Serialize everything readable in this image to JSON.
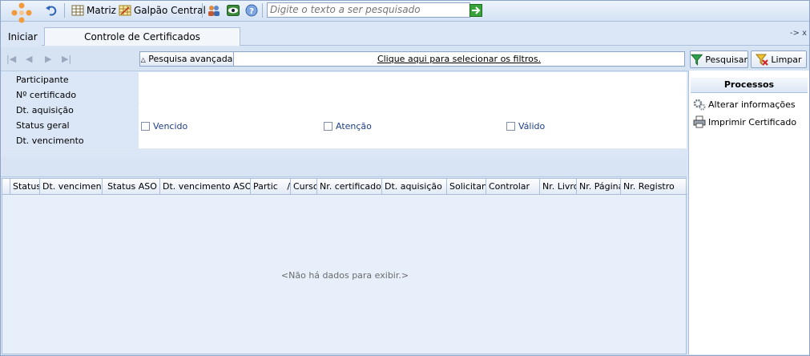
{
  "toolbar": {
    "matriz_label": "Matriz",
    "galpao_label": "Galpão Central",
    "search_placeholder": "Digite o texto a ser pesquisado"
  },
  "start": {
    "label": "Iniciar"
  },
  "tabs": [
    {
      "label": "Controle de Certificados"
    }
  ],
  "filters": {
    "advanced_label": "Pesquisa avançada",
    "select_filters_text": "Clique aqui para selecionar os filtros.",
    "search_button": "Pesquisar",
    "clear_button": "Limpar"
  },
  "form": {
    "participante_label": "Participante",
    "certificado_label": "Nº certificado",
    "aquisicao_label": "Dt. aquisição",
    "status_label": "Status geral",
    "vencimento_label": "Dt. vencimento",
    "status_options": [
      "Vencido",
      "Atenção",
      "Válido"
    ]
  },
  "grid": {
    "columns": [
      "Status",
      "Dt. vencimento",
      "Status ASO",
      "Dt. vencimento ASO",
      "Partic",
      "Curso",
      "Nr. certificado",
      "Dt. aquisição",
      "Solicitante",
      "Controlar",
      "Nr. Livro",
      "Nr. Página",
      "Nr. Registro"
    ],
    "sort_indicator": "/",
    "empty_message": "<Não há dados para exibir.>"
  },
  "processes": {
    "title": "Processos",
    "items": [
      "Alterar informações",
      "Imprimir Certificado"
    ]
  },
  "pin_label": "-> x"
}
